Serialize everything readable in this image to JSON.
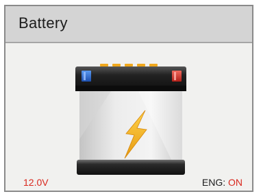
{
  "header": {
    "title": "Battery"
  },
  "battery": {
    "icon": "battery-icon",
    "terminal_negative_color": "#2f6fd8",
    "terminal_positive_color": "#d8322a",
    "bolt_color": "#f2b318"
  },
  "status": {
    "voltage": "12.0V",
    "engine_label": "ENG:",
    "engine_state": "ON"
  },
  "colors": {
    "alert": "#d9261c",
    "header_bg": "#d4d4d4"
  }
}
